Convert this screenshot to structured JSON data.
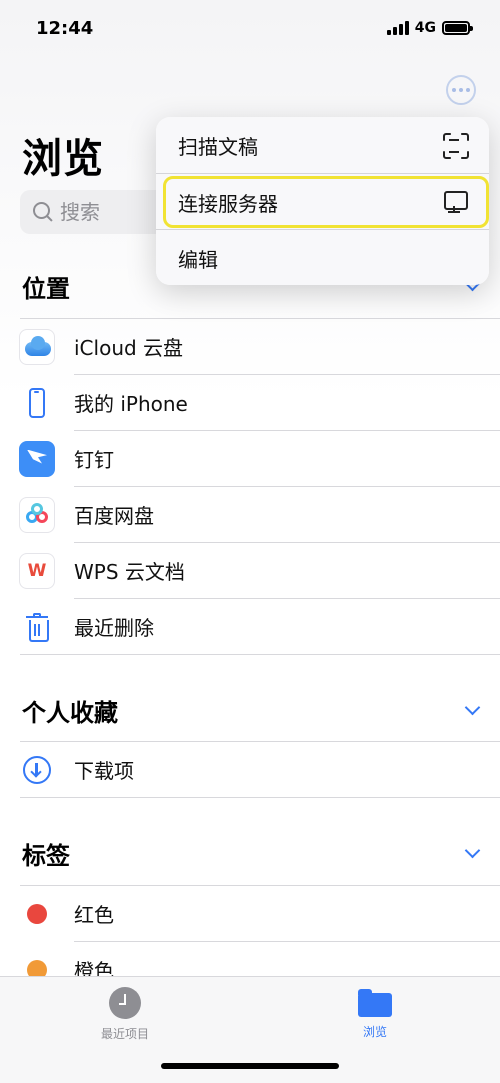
{
  "status_bar": {
    "time": "12:44",
    "network": "4G"
  },
  "header": {
    "title": "浏览"
  },
  "search": {
    "placeholder": "搜索"
  },
  "locations": {
    "title": "位置",
    "items": [
      {
        "label": "iCloud 云盘",
        "icon": "icloud-icon"
      },
      {
        "label": "我的 iPhone",
        "icon": "iphone-icon"
      },
      {
        "label": "钉钉",
        "icon": "dingtalk-icon"
      },
      {
        "label": "百度网盘",
        "icon": "baidu-netdisk-icon"
      },
      {
        "label": "WPS 云文档",
        "icon": "wps-icon"
      },
      {
        "label": "最近删除",
        "icon": "trash-icon"
      }
    ]
  },
  "favorites": {
    "title": "个人收藏",
    "items": [
      {
        "label": "下载项",
        "icon": "download-icon"
      }
    ]
  },
  "tags": {
    "title": "标签",
    "items": [
      {
        "label": "红色",
        "color": "#e9473e"
      },
      {
        "label": "橙色",
        "color": "#f19a37"
      }
    ]
  },
  "menu": {
    "items": [
      {
        "label": "扫描文稿",
        "icon": "scan-document-icon"
      },
      {
        "label": "连接服务器",
        "icon": "server-icon",
        "highlighted": true
      },
      {
        "label": "编辑"
      }
    ]
  },
  "tab_bar": {
    "tabs": [
      {
        "label": "最近项目",
        "icon": "clock-icon",
        "active": false
      },
      {
        "label": "浏览",
        "icon": "folder-icon",
        "active": true
      }
    ]
  },
  "colors": {
    "accent": "#3478f6",
    "highlight": "#f1e333"
  }
}
